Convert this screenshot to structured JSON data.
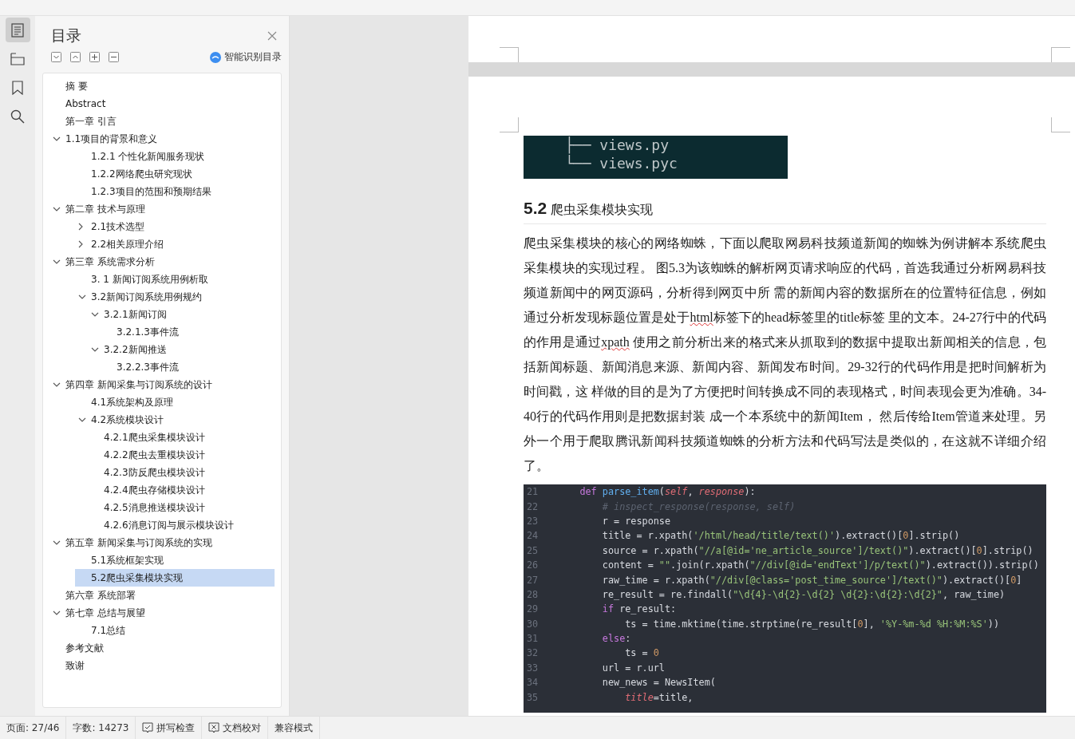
{
  "rail": {
    "items": [
      {
        "kind": "outline",
        "selected": true
      },
      {
        "kind": "tree",
        "selected": false
      },
      {
        "kind": "bookmark",
        "selected": false
      },
      {
        "kind": "search",
        "selected": false
      }
    ]
  },
  "toc": {
    "title": "目录",
    "smart_label": "智能识别目录",
    "items": [
      {
        "label": "摘 要",
        "selected": false
      },
      {
        "label": "Abstract",
        "selected": false
      },
      {
        "label": "第一章 引言",
        "selected": false
      },
      {
        "label": "1.1项目的背景和意义",
        "selected": false,
        "expanded": true,
        "children": [
          {
            "label": "1.2.1 个性化新闻服务现状",
            "selected": false
          },
          {
            "label": "1.2.2网络爬虫研究现状",
            "selected": false
          },
          {
            "label": "1.2.3项目的范围和预期结果",
            "selected": false
          }
        ]
      },
      {
        "label": "第二章 技术与原理",
        "selected": false,
        "expanded": true,
        "children": [
          {
            "label": "2.1技术选型",
            "selected": false,
            "expanded": false
          },
          {
            "label": "2.2相关原理介绍",
            "selected": false,
            "expanded": false
          }
        ]
      },
      {
        "label": "第三章 系统需求分析",
        "selected": false,
        "expanded": true,
        "children": [
          {
            "label": "3. 1 新闻订阅系统用例析取",
            "selected": false
          },
          {
            "label": "3.2新闻订阅系统用例规约",
            "selected": false,
            "expanded": true,
            "children": [
              {
                "label": "3.2.1新闻订阅",
                "selected": false,
                "expanded": true,
                "children": [
                  {
                    "label": "3.2.1.3事件流",
                    "selected": false
                  }
                ]
              },
              {
                "label": "3.2.2新闻推送",
                "selected": false,
                "expanded": true,
                "children": [
                  {
                    "label": "3.2.2.3事件流",
                    "selected": false
                  }
                ]
              }
            ]
          }
        ]
      },
      {
        "label": "第四章 新闻采集与订阅系统的设计",
        "selected": false,
        "expanded": true,
        "children": [
          {
            "label": "4.1系统架构及原理",
            "selected": false
          },
          {
            "label": "4.2系统模块设计",
            "selected": false,
            "expanded": true,
            "children": [
              {
                "label": "4.2.1爬虫采集模块设计",
                "selected": false
              },
              {
                "label": "4.2.2爬虫去重模块设计",
                "selected": false
              },
              {
                "label": "4.2.3防反爬虫模块设计",
                "selected": false
              },
              {
                "label": "4.2.4爬虫存储模块设计",
                "selected": false
              },
              {
                "label": "4.2.5消息推送模块设计",
                "selected": false
              },
              {
                "label": "4.2.6消息订阅与展示模块设计",
                "selected": false
              }
            ]
          }
        ]
      },
      {
        "label": "第五章 新闻采集与订阅系统的实现",
        "selected": false,
        "expanded": true,
        "children": [
          {
            "label": "5.1系统框架实现",
            "selected": false
          },
          {
            "label": "5.2爬虫采集模块实现",
            "selected": true
          }
        ]
      },
      {
        "label": "第六章 系统部署",
        "selected": false
      },
      {
        "label": "第七章 总结与展望",
        "selected": false,
        "expanded": true,
        "children": [
          {
            "label": "7.1总结",
            "selected": false
          }
        ]
      },
      {
        "label": "参考文献",
        "selected": false
      },
      {
        "label": "致谢",
        "selected": false
      }
    ]
  },
  "document": {
    "file_listing": [
      "├── views.py",
      "└── views.pyc"
    ],
    "heading": {
      "number": "5.2",
      "title": "爬虫采集模块实现"
    },
    "paragraph": [
      {
        "text": "爬虫采集模块的核心的网络蜘蛛，下面以爬取网易科技频道新闻的蜘蛛为例讲解本系统爬虫采集模块的实现过程。 图5.3为该蜘蛛的解析网页请求响应的代码，首选我通过分析网易科技频道新闻中的网页源码，分析得到网页中所 需的新闻内容的数据所在的位置特征信息，例如通过分析发现标题位置是处于",
        "misspelled": false
      },
      {
        "text": "html",
        "misspelled": true
      },
      {
        "text": "标签下的head标签里的title标签 里的文本。24-27行中的代码的作用是通过",
        "misspelled": false
      },
      {
        "text": "xpath",
        "misspelled": true
      },
      {
        "text": " 使用之前分析出来的格式来从抓取到的数据中提取出新闻相关的信息，包括新闻标题、新闻消息来源、新闻内容、新闻发布时间。29-32行的代码作用是把时间解析为时间戳，这 样做的目的是为了方便把时间转换成不同的表现格式，时间表现会更为准确。34-40行的代码作用则是把数据封装 成一个本系统中的新闻Item， 然后传给Item管道来处理。另外一个用于爬取腾讯新闻科技频道蜘蛛的分析方法和代码写法是类似的，在这就不详细介绍了。",
        "misspelled": false
      }
    ],
    "code": [
      {
        "number": "21",
        "tokens": [
          {
            "text": "    def ",
            "kind": "keyword"
          },
          {
            "text": "parse_item",
            "kind": "function"
          },
          {
            "text": "(",
            "kind": "plain"
          },
          {
            "text": "self",
            "kind": "param"
          },
          {
            "text": ", ",
            "kind": "plain"
          },
          {
            "text": "response",
            "kind": "param"
          },
          {
            "text": "):",
            "kind": "plain"
          }
        ]
      },
      {
        "number": "22",
        "tokens": [
          {
            "text": "        # inspect_response(response, self)",
            "kind": "comment"
          }
        ]
      },
      {
        "number": "23",
        "tokens": [
          {
            "text": "        r = response",
            "kind": "plain"
          }
        ]
      },
      {
        "number": "24",
        "tokens": [
          {
            "text": "        title = r.xpath(",
            "kind": "plain"
          },
          {
            "text": "'/html/head/title/text()'",
            "kind": "string"
          },
          {
            "text": ").extract()[",
            "kind": "plain"
          },
          {
            "text": "0",
            "kind": "number"
          },
          {
            "text": "].strip()",
            "kind": "plain"
          }
        ]
      },
      {
        "number": "25",
        "tokens": [
          {
            "text": "        source = r.xpath(",
            "kind": "plain"
          },
          {
            "text": "\"//a[@id='ne_article_source']/text()\"",
            "kind": "string"
          },
          {
            "text": ").extract()[",
            "kind": "plain"
          },
          {
            "text": "0",
            "kind": "number"
          },
          {
            "text": "].strip()",
            "kind": "plain"
          }
        ]
      },
      {
        "number": "26",
        "tokens": [
          {
            "text": "        content = ",
            "kind": "plain"
          },
          {
            "text": "\"\"",
            "kind": "string"
          },
          {
            "text": ".join(r.xpath(",
            "kind": "plain"
          },
          {
            "text": "\"//div[@id='endText']/p/text()\"",
            "kind": "string"
          },
          {
            "text": ").extract()).strip()",
            "kind": "plain"
          }
        ]
      },
      {
        "number": "27",
        "tokens": [
          {
            "text": "        raw_time = r.xpath(",
            "kind": "plain"
          },
          {
            "text": "\"//div[@class='post_time_source']/text()\"",
            "kind": "string"
          },
          {
            "text": ").extract()[",
            "kind": "plain"
          },
          {
            "text": "0",
            "kind": "number"
          },
          {
            "text": "]",
            "kind": "plain"
          }
        ]
      },
      {
        "number": "28",
        "tokens": [
          {
            "text": "        re_result = re.findall(",
            "kind": "plain"
          },
          {
            "text": "\"\\d{4}-\\d{2}-\\d{2} \\d{2}:\\d{2}:\\d{2}\"",
            "kind": "string"
          },
          {
            "text": ", raw_time)",
            "kind": "plain"
          }
        ]
      },
      {
        "number": "29",
        "tokens": [
          {
            "text": "        if",
            "kind": "keyword"
          },
          {
            "text": " re_result:",
            "kind": "plain"
          }
        ]
      },
      {
        "number": "30",
        "tokens": [
          {
            "text": "            ts = time.mktime(time.strptime(re_result[",
            "kind": "plain"
          },
          {
            "text": "0",
            "kind": "number"
          },
          {
            "text": "], ",
            "kind": "plain"
          },
          {
            "text": "'%Y-%m-%d %H:%M:%S'",
            "kind": "string"
          },
          {
            "text": "))",
            "kind": "plain"
          }
        ]
      },
      {
        "number": "31",
        "tokens": [
          {
            "text": "        else",
            "kind": "keyword"
          },
          {
            "text": ":",
            "kind": "plain"
          }
        ]
      },
      {
        "number": "32",
        "tokens": [
          {
            "text": "            ts = ",
            "kind": "plain"
          },
          {
            "text": "0",
            "kind": "number"
          }
        ]
      },
      {
        "number": "33",
        "tokens": [
          {
            "text": "        url = r.url",
            "kind": "plain"
          }
        ]
      },
      {
        "number": "34",
        "tokens": [
          {
            "text": "        new_news = NewsItem(",
            "kind": "plain"
          }
        ]
      },
      {
        "number": "35",
        "tokens": [
          {
            "text": "            title",
            "kind": "param"
          },
          {
            "text": "=title,",
            "kind": "plain"
          }
        ]
      }
    ]
  },
  "status_bar": [
    {
      "kind": "text",
      "label": "页面: 27/46"
    },
    {
      "kind": "text",
      "label": "字数: 14273"
    },
    {
      "kind": "check",
      "label": "拼写检查"
    },
    {
      "kind": "cross",
      "label": "文档校对"
    },
    {
      "kind": "text",
      "label": "兼容模式"
    }
  ]
}
